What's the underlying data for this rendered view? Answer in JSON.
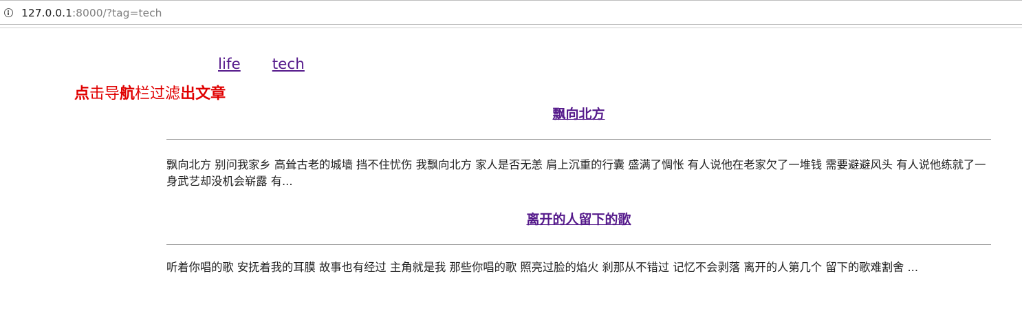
{
  "browser": {
    "url_host": "127.0.0.1",
    "url_rest": ":8000/?tag=tech"
  },
  "nav": {
    "links": [
      "life",
      "tech"
    ]
  },
  "hint": {
    "text_parts": [
      "点",
      "击导",
      "航",
      "栏过滤",
      "出文章"
    ]
  },
  "articles": [
    {
      "title": "飘向北方",
      "excerpt": "飘向北方 别问我家乡 高耸古老的城墙 挡不住忧伤 我飘向北方 家人是否无恙 肩上沉重的行囊 盛满了惆怅 有人说他在老家欠了一堆钱 需要避避风头 有人说他练就了一身武艺却没机会崭露 有..."
    },
    {
      "title": "离开的人留下的歌",
      "excerpt": "听着你唱的歌 安抚着我的耳膜 故事也有经过 主角就是我 那些你唱的歌 照亮过脸的焰火 刹那从不错过 记忆不会剥落 离开的人第几个 留下的歌难割舍 ..."
    }
  ]
}
